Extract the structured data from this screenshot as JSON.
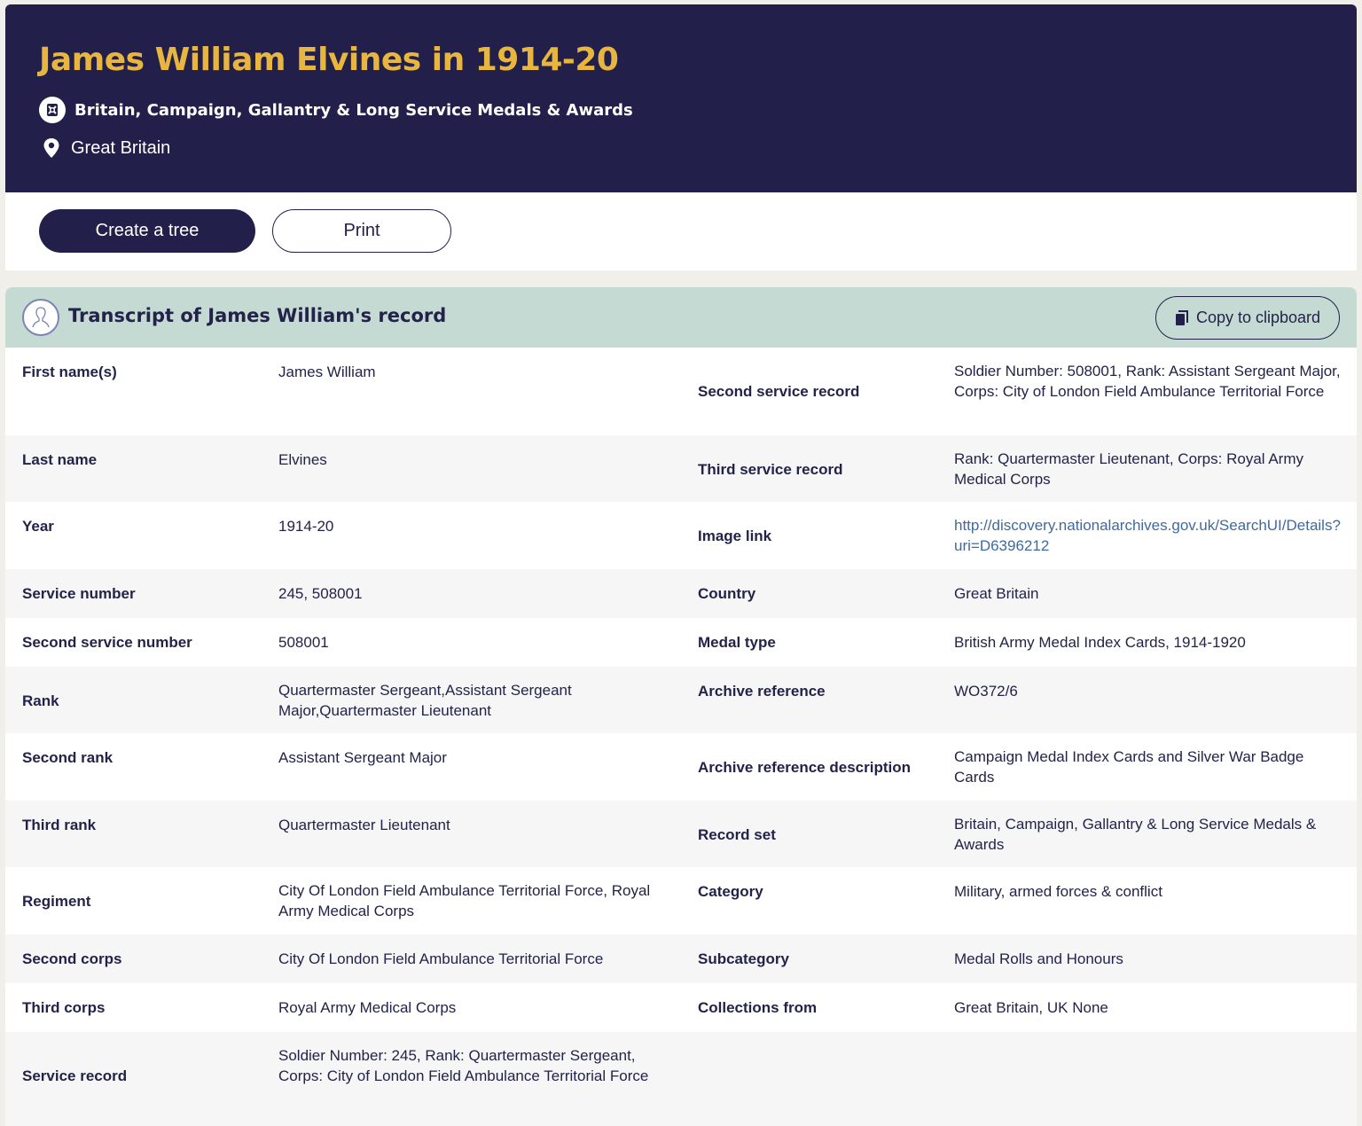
{
  "header": {
    "title": "James William Elvines in 1914-20",
    "record_set": "Britain, Campaign, Gallantry & Long Service Medals & Awards",
    "location": "Great Britain"
  },
  "actions": {
    "create_tree": "Create a tree",
    "print": "Print"
  },
  "transcript": {
    "title": "Transcript of James William's record",
    "copy_label": "Copy to clipboard",
    "rows": [
      {
        "l1": "First name(s)",
        "v1": "James William",
        "l2": "Second service record",
        "v2": "Soldier Number: 508001, Rank: Assistant Sergeant Major, Corps: City of London Field Ambulance Territorial Force"
      },
      {
        "l1": "Last name",
        "v1": "Elvines",
        "l2": "Third service record",
        "v2": "Rank: Quartermaster Lieutenant, Corps: Royal Army Medical Corps"
      },
      {
        "l1": "Year",
        "v1": "1914-20",
        "l2": "Image link",
        "v2": "http://discovery.nationalarchives.gov.uk/SearchUI/Details?uri=D6396212"
      },
      {
        "l1": "Service number",
        "v1": "245, 508001",
        "l2": "Country",
        "v2": "Great Britain"
      },
      {
        "l1": "Second service number",
        "v1": "508001",
        "l2": "Medal type",
        "v2": "British Army Medal Index Cards, 1914-1920"
      },
      {
        "l1": "Rank",
        "v1": "Quartermaster Sergeant,Assistant Sergeant Major,Quartermaster Lieutenant",
        "l2": "Archive reference",
        "v2": "WO372/6"
      },
      {
        "l1": "Second rank",
        "v1": "Assistant Sergeant Major",
        "l2": "Archive reference description",
        "v2": "Campaign Medal Index Cards and Silver War Badge Cards"
      },
      {
        "l1": "Third rank",
        "v1": "Quartermaster Lieutenant",
        "l2": "Record set",
        "v2": "Britain, Campaign, Gallantry & Long Service Medals & Awards"
      },
      {
        "l1": "Regiment",
        "v1": "City Of London Field Ambulance Territorial Force, Royal Army Medical Corps",
        "l2": "Category",
        "v2": "Military, armed forces & conflict"
      },
      {
        "l1": "Second corps",
        "v1": "City Of London Field Ambulance Territorial Force",
        "l2": "Subcategory",
        "v2": "Medal Rolls and Honours"
      },
      {
        "l1": "Third corps",
        "v1": "Royal Army Medical Corps",
        "l2": "Collections from",
        "v2": "Great Britain, UK None"
      },
      {
        "l1": "Service record",
        "v1": "Soldier Number: 245, Rank: Quartermaster Sergeant, Corps: City of London Field Ambulance Territorial Force",
        "l2": "",
        "v2": ""
      }
    ]
  },
  "colors": {
    "navy": "#22204a",
    "gold": "#e8b63f",
    "mint": "#c5dad3",
    "link": "#3f6a9e"
  }
}
